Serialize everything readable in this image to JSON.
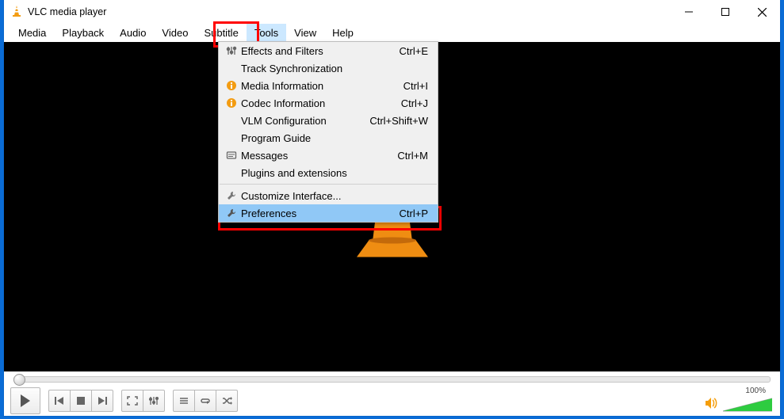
{
  "titlebar": {
    "title": "VLC media player"
  },
  "menubar": {
    "items": [
      {
        "label": "Media"
      },
      {
        "label": "Playback"
      },
      {
        "label": "Audio"
      },
      {
        "label": "Video"
      },
      {
        "label": "Subtitle"
      },
      {
        "label": "Tools"
      },
      {
        "label": "View"
      },
      {
        "label": "Help"
      }
    ],
    "active_index": 5
  },
  "tools_menu": {
    "items": [
      {
        "label": "Effects and Filters",
        "shortcut": "Ctrl+E",
        "icon": "sliders"
      },
      {
        "label": "Track Synchronization",
        "shortcut": "",
        "icon": ""
      },
      {
        "label": "Media Information",
        "shortcut": "Ctrl+I",
        "icon": "info"
      },
      {
        "label": "Codec Information",
        "shortcut": "Ctrl+J",
        "icon": "info"
      },
      {
        "label": "VLM Configuration",
        "shortcut": "Ctrl+Shift+W",
        "icon": ""
      },
      {
        "label": "Program Guide",
        "shortcut": "",
        "icon": ""
      },
      {
        "label": "Messages",
        "shortcut": "Ctrl+M",
        "icon": "messages"
      },
      {
        "label": "Plugins and extensions",
        "shortcut": "",
        "icon": ""
      }
    ],
    "items2": [
      {
        "label": "Customize Interface...",
        "shortcut": "",
        "icon": "wrench"
      },
      {
        "label": "Preferences",
        "shortcut": "Ctrl+P",
        "icon": "wrench",
        "selected": true
      }
    ]
  },
  "volume": {
    "percent_label": "100%"
  }
}
